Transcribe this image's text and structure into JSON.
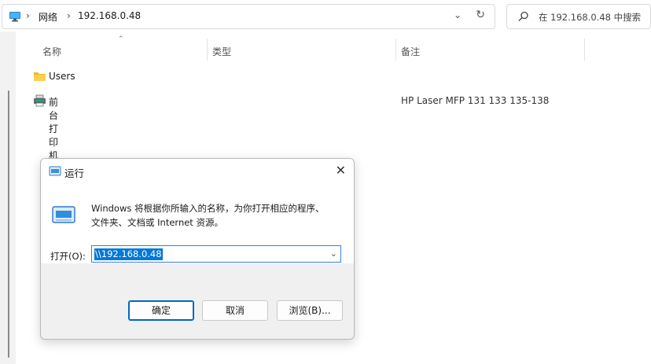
{
  "address_bar": {
    "breadcrumbs": [
      "网络",
      "192.168.0.48"
    ]
  },
  "search": {
    "placeholder": "在 192.168.0.48 中搜索"
  },
  "columns": {
    "name": "名称",
    "type": "类型",
    "note": "备注"
  },
  "items": [
    {
      "name": "Users",
      "icon": "folder-icon",
      "note": ""
    },
    {
      "name": "前台打印机",
      "icon": "printer-icon",
      "note": "HP Laser MFP 131 133 135-138"
    }
  ],
  "run_dialog": {
    "title": "运行",
    "description_line1": "Windows 将根据你所输入的名称，为你打开相应的程序、",
    "description_line2": "文件夹、文档或 Internet 资源。",
    "open_label": "打开(O):",
    "open_value": "\\\\192.168.0.48",
    "ok_label": "确定",
    "cancel_label": "取消",
    "browse_label": "浏览(B)..."
  }
}
